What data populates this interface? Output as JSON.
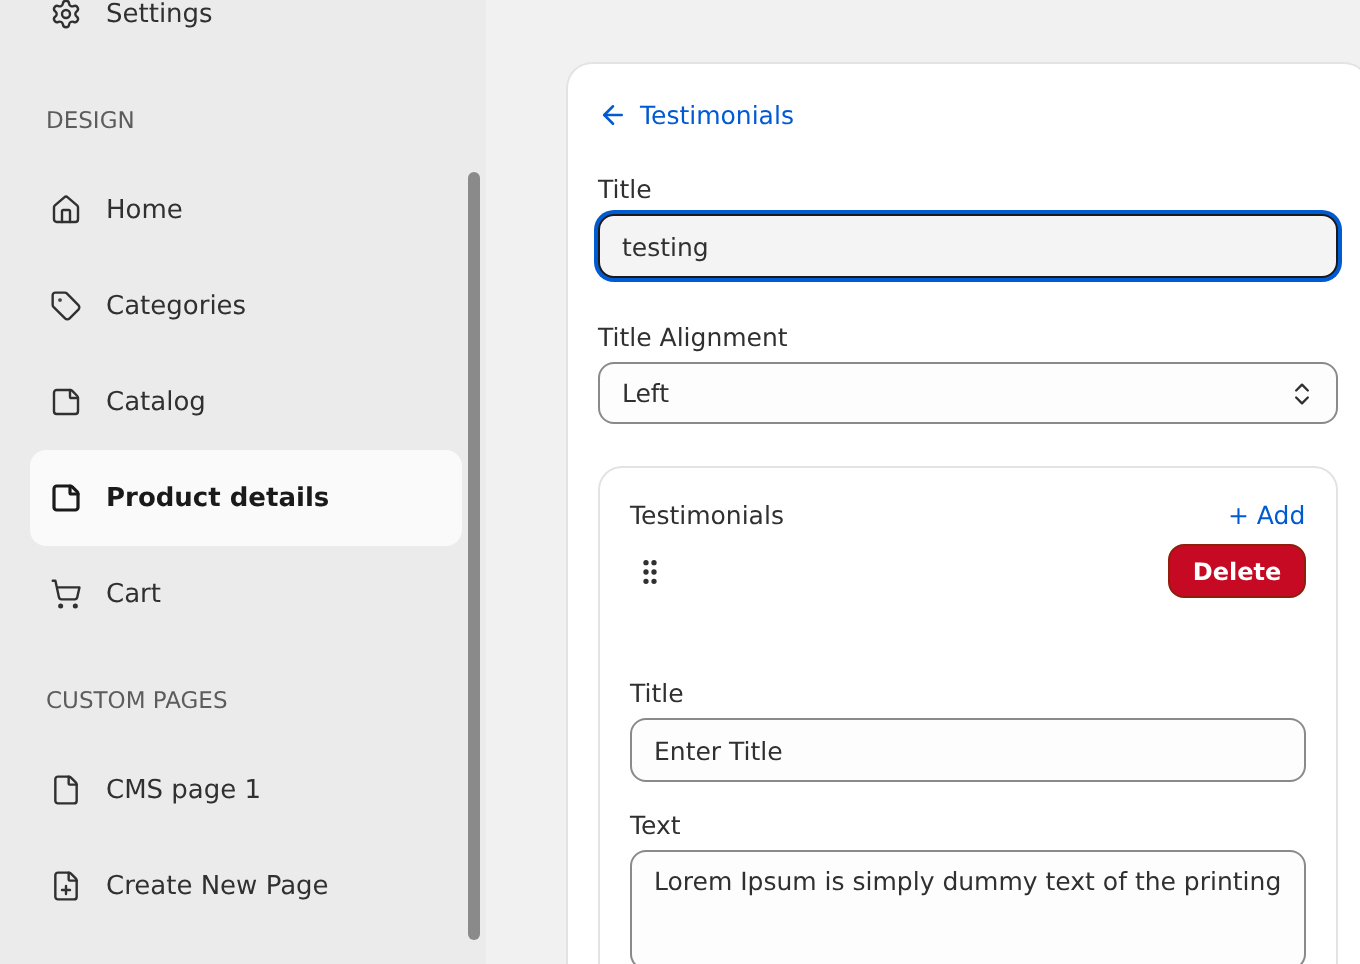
{
  "sidebar": {
    "sections": [
      {
        "items": [
          {
            "label": "Settings",
            "kind": "settings",
            "selected": false
          }
        ]
      },
      {
        "heading": "DESIGN",
        "items": [
          {
            "label": "Home",
            "kind": "home",
            "selected": false
          },
          {
            "label": "Categories",
            "kind": "tag",
            "selected": false
          },
          {
            "label": "Catalog",
            "kind": "note",
            "selected": false
          },
          {
            "label": "Product details",
            "kind": "note",
            "selected": true
          },
          {
            "label": "Cart",
            "kind": "cart",
            "selected": false
          }
        ]
      },
      {
        "heading": "CUSTOM PAGES",
        "items": [
          {
            "label": "CMS page 1",
            "kind": "file",
            "selected": false
          },
          {
            "label": "Create New Page",
            "kind": "file-plus",
            "selected": false
          }
        ]
      }
    ]
  },
  "editor": {
    "back_link": "Testimonials",
    "title_field": {
      "label": "Title",
      "value": "testing",
      "focused": true
    },
    "alignment_select": {
      "label": "Title Alignment",
      "value": "Left"
    },
    "testimonials": {
      "heading": "Testimonials",
      "add_button": "+ Add",
      "items": [
        {
          "delete_button": "Delete",
          "title_field": {
            "label": "Title",
            "placeholder": "Enter Title"
          },
          "text_field": {
            "label": "Text",
            "value": "Lorem Ipsum is simply dummy text of the printing"
          }
        }
      ]
    }
  }
}
